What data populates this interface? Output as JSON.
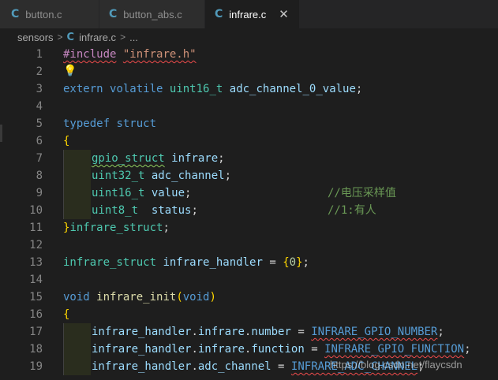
{
  "tabs": [
    {
      "label": "button.c",
      "icon": "c-file-icon"
    },
    {
      "label": "button_abs.c",
      "icon": "c-file-icon"
    },
    {
      "label": "infrare.c",
      "icon": "c-file-icon",
      "active": true
    }
  ],
  "icon_glyph": "C",
  "close_glyph": "✕",
  "breadcrumb": {
    "folder": "sensors",
    "sep": ">",
    "file": "infrare.c",
    "more": "..."
  },
  "lightbulb": "💡",
  "line_numbers": [
    "1",
    "2",
    "3",
    "4",
    "5",
    "6",
    "7",
    "8",
    "9",
    "10",
    "11",
    "12",
    "13",
    "14",
    "15",
    "16",
    "17",
    "18",
    "19"
  ],
  "code": {
    "l1": {
      "directive": "#include",
      "path": "\"infrare.h\""
    },
    "l3": {
      "kw1": "extern",
      "kw2": "volatile",
      "type": "uint16_t",
      "name": "adc_channel_0_value",
      "semi": ";"
    },
    "l5": {
      "kw1": "typedef",
      "kw2": "struct"
    },
    "l6": {
      "brace": "{"
    },
    "l7": {
      "type": "gpio_struct",
      "name": "infrare",
      "semi": ";"
    },
    "l8": {
      "type": "uint32_t",
      "name": "adc_channel",
      "semi": ";"
    },
    "l9": {
      "type": "uint16_t",
      "name": "value",
      "semi": ";",
      "comment": "//电压采样值"
    },
    "l10": {
      "type": "uint8_t",
      "name": "status",
      "semi": ";",
      "comment": "//1:有人"
    },
    "l11": {
      "brace": "}",
      "name": "infrare_struct",
      "semi": ";"
    },
    "l13": {
      "type": "infrare_struct",
      "name": "infrare_handler",
      "op": "=",
      "open": "{",
      "val": "0",
      "close": "}",
      "semi": ";"
    },
    "l15": {
      "kw": "void",
      "fn": "infrare_init",
      "open": "(",
      "arg": "void",
      "close": ")"
    },
    "l16": {
      "brace": "{"
    },
    "l17": {
      "obj": "infrare_handler",
      "f1": "infrare",
      "f2": "number",
      "op": "=",
      "val": "INFRARE_GPIO_NUMBER",
      "semi": ";"
    },
    "l18": {
      "obj": "infrare_handler",
      "f1": "infrare",
      "f2": "function",
      "op": "=",
      "val": "INFRARE_GPIO_FUNCTION",
      "semi": ";"
    },
    "l19": {
      "obj": "infrare_handler",
      "f1": "adc_channel",
      "op": "=",
      "val": "INFRARE_ADC_CHANNEL",
      "semi": ";"
    }
  },
  "watermark": "https://blog.csdn.net/flaycsdn"
}
